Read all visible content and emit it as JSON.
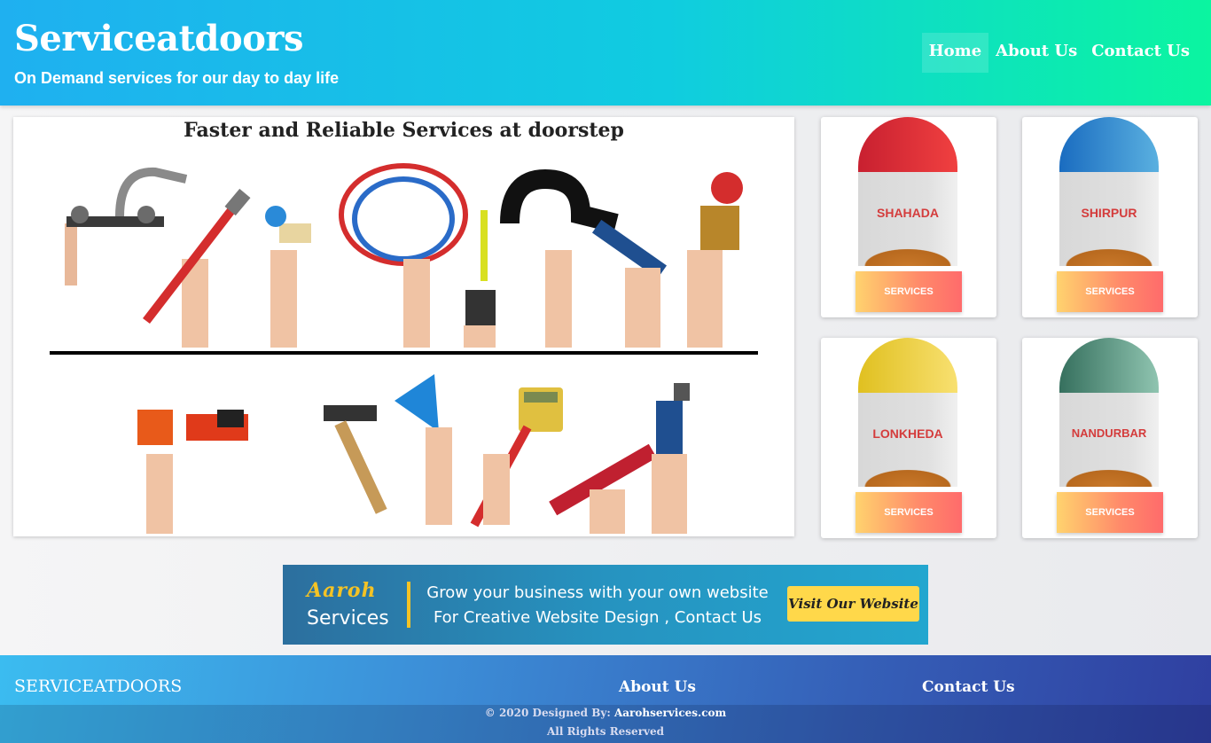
{
  "header": {
    "brand": "Serviceatdoors",
    "tagline": "On Demand services for our day to day life",
    "nav": [
      {
        "label": "Home",
        "active": true
      },
      {
        "label": "About Us",
        "active": false
      },
      {
        "label": "Contact Us",
        "active": false
      }
    ]
  },
  "hero": {
    "title": "Faster and Reliable Services at doorstep",
    "image_description_icons": [
      "faucet-icon",
      "wrench-icon",
      "hose-icon",
      "hammer-icon",
      "drill-icon"
    ]
  },
  "cities": [
    {
      "name": "SHAHADA",
      "button": "SERVICES",
      "cap_color": "#d62a3a"
    },
    {
      "name": "SHIRPUR",
      "button": "SERVICES",
      "cap_color": "#1f7ac8"
    },
    {
      "name": "LONKHEDA",
      "button": "SERVICES",
      "cap_color": "#e6c22a"
    },
    {
      "name": "NANDURBAR",
      "button": "SERVICES",
      "cap_color": "#3f7a6a"
    }
  ],
  "ad": {
    "brand": "Aaroh",
    "brand_sub": "Services",
    "line1": "Grow your business with your own website",
    "line2": "For Creative Website Design , Contact Us",
    "button": "Visit Our Website"
  },
  "footer": {
    "brand": "SERVICEATDOORS",
    "about": "About Us",
    "contact": "Contact Us",
    "designed_by_prefix": "© 2020 Designed By:",
    "designed_by_link": "Aarohservices.com",
    "rights": "All Rights Reserved"
  },
  "colors": {
    "header_gradient_start": "#1fb0f0",
    "header_gradient_end": "#0bf5a0",
    "button_gradient_start": "#ffd36e",
    "button_gradient_end": "#ff6b6b",
    "ad_button": "#ffd84a",
    "ad_accent": "#f4c325"
  }
}
